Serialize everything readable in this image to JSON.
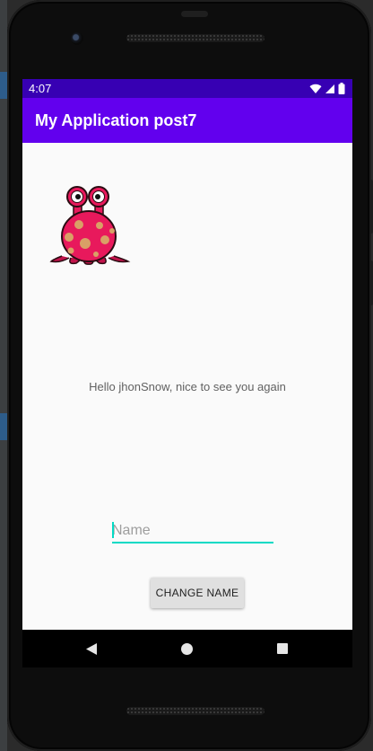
{
  "status_bar": {
    "time": "4:07",
    "icons": [
      "wifi-icon",
      "signal-icon",
      "battery-icon"
    ]
  },
  "app_bar": {
    "title": "My Application post7",
    "color": "#6200ee",
    "status_color": "#3700b3"
  },
  "content": {
    "image_icon": "monster-icon",
    "greeting": "Hello jhonSnow, nice to see you again",
    "name_input": {
      "value": "",
      "placeholder": "Name",
      "accent_color": "#03dac5"
    },
    "change_button_label": "CHANGE NAME"
  },
  "nav_bar": {
    "icons": [
      "back-icon",
      "home-icon",
      "recents-icon"
    ]
  }
}
